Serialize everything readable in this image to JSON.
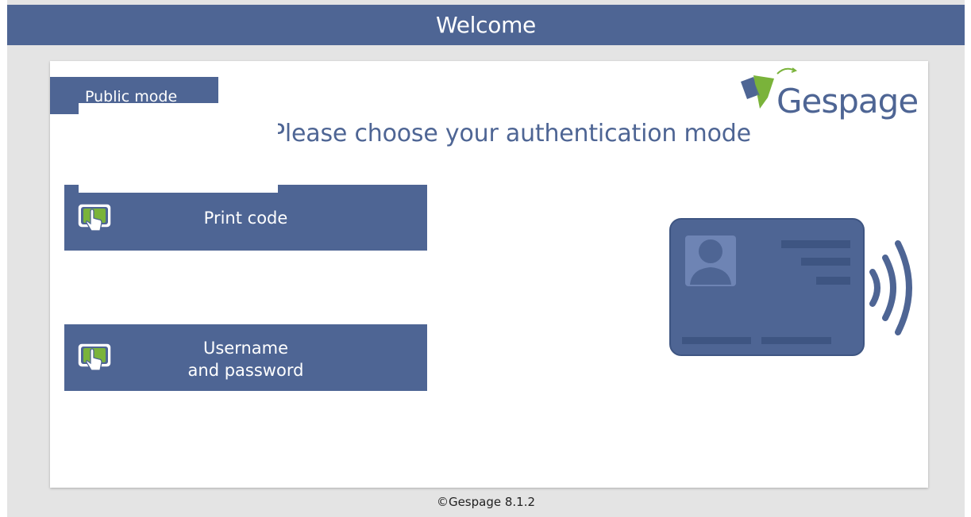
{
  "header": {
    "title": "Welcome"
  },
  "mode": {
    "label": "Public mode"
  },
  "prompt": {
    "text": "Please choose your authentication mode"
  },
  "buttons": [
    {
      "label_line1": "Print code",
      "label_line2": "",
      "icon": "touch-screen-icon"
    },
    {
      "label_line1": "Username",
      "label_line2": "and password",
      "icon": "touch-screen-icon"
    }
  ],
  "logo": {
    "text": "Gespage"
  },
  "card_graphic": {
    "icon": "contactless-card-icon"
  },
  "footer": {
    "text": "©Gespage 8.1.2"
  },
  "colors": {
    "primary": "#4e6594",
    "background": "#e4e4e4",
    "logo_green": "#7ab33a",
    "card_avatar": "#6e84b4"
  }
}
